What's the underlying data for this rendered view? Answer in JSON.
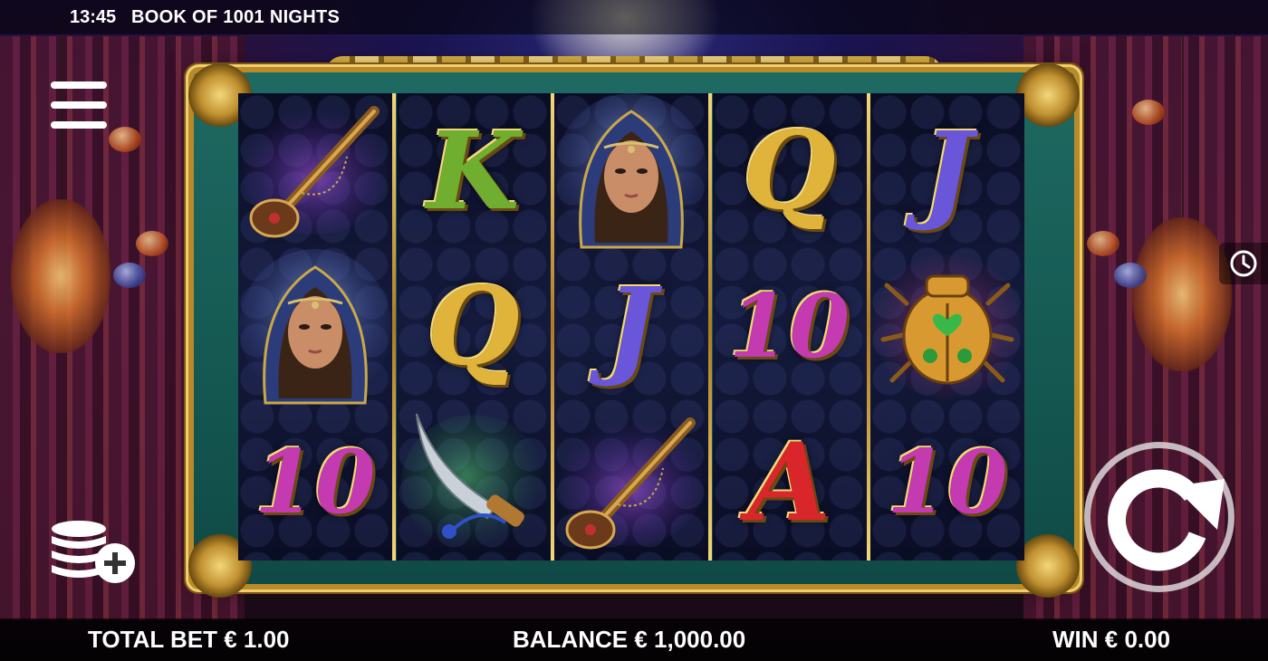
{
  "status_bar": {
    "time": "13:45",
    "game_title": "BOOK OF 1001 NIGHTS"
  },
  "reels": [
    [
      {
        "symbol": "flute",
        "label": ""
      },
      {
        "symbol": "princess",
        "label": ""
      },
      {
        "symbol": "ten",
        "label": "10"
      }
    ],
    [
      {
        "symbol": "king",
        "label": "K"
      },
      {
        "symbol": "queen",
        "label": "Q"
      },
      {
        "symbol": "dagger",
        "label": ""
      }
    ],
    [
      {
        "symbol": "princess",
        "label": ""
      },
      {
        "symbol": "jack",
        "label": "J"
      },
      {
        "symbol": "flute",
        "label": ""
      }
    ],
    [
      {
        "symbol": "queen",
        "label": "Q"
      },
      {
        "symbol": "ten",
        "label": "10"
      },
      {
        "symbol": "ace",
        "label": "A"
      }
    ],
    [
      {
        "symbol": "jack",
        "label": "J"
      },
      {
        "symbol": "scarab",
        "label": ""
      },
      {
        "symbol": "ten",
        "label": "10"
      }
    ]
  ],
  "symbol_colors": {
    "king": "#6fae2e",
    "queen": "#e0b43a",
    "jack": "#6a56d8",
    "ten": "#c43ab0",
    "ace": "#d8262a"
  },
  "controls": {
    "menu_icon": "hamburger-menu-icon",
    "bet_icon": "coin-stack-plus-icon",
    "spin_icon": "spin-arrow-icon",
    "history_icon": "clock-history-icon"
  },
  "footer": {
    "total_bet": "TOTAL BET € 1.00",
    "balance": "BALANCE € 1,000.00",
    "win": "WIN € 0.00"
  }
}
